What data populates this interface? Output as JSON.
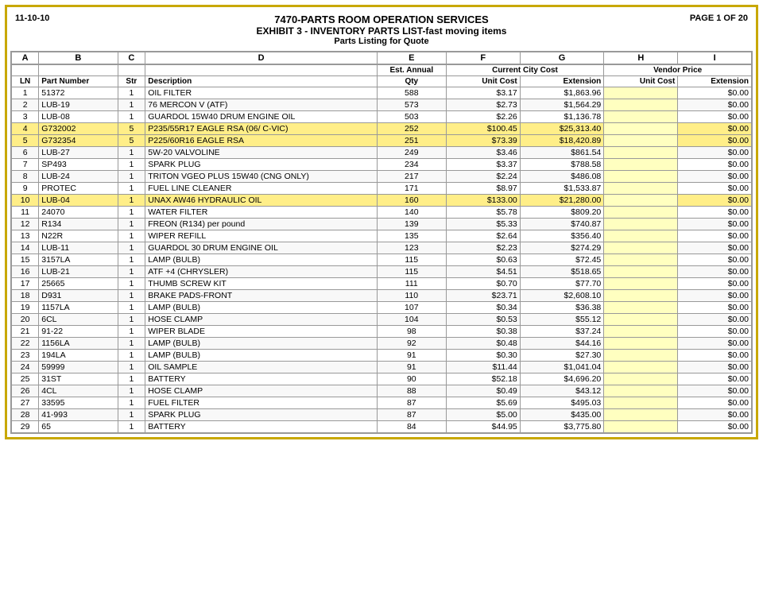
{
  "header": {
    "date": "11-10-10",
    "page": "PAGE 1 OF 20",
    "title1": "7470-PARTS ROOM OPERATION SERVICES",
    "title2": "EXHIBIT 3 - INVENTORY PARTS LIST-fast moving items",
    "title3": "Parts Listing for Quote"
  },
  "columns": {
    "letters": [
      "A",
      "B",
      "C",
      "D",
      "E",
      "F",
      "G",
      "H",
      "I"
    ],
    "subheaders_ef": "Est. Annual",
    "subheaders_fg": "Current City Cost",
    "subheaders_hi": "Vendor Price",
    "col_labels": {
      "ln": "LN",
      "part": "Part Number",
      "str": "Str",
      "desc": "Description",
      "qty": "Qty",
      "unit_cost": "Unit Cost",
      "extension": "Extension",
      "unit_cost2": "Unit Cost",
      "extension2": "Extension"
    }
  },
  "rows": [
    {
      "ln": 1,
      "part": "51372",
      "str": 1,
      "desc": "OIL FILTER",
      "qty": 588,
      "unit": "$3.17",
      "ext": "$1,863.96",
      "vunit": "",
      "vext": "$0.00"
    },
    {
      "ln": 2,
      "part": "LUB-19",
      "str": 1,
      "desc": "76 MERCON V (ATF)",
      "qty": 573,
      "unit": "$2.73",
      "ext": "$1,564.29",
      "vunit": "",
      "vext": "$0.00"
    },
    {
      "ln": 3,
      "part": "LUB-08",
      "str": 1,
      "desc": "GUARDOL 15W40 DRUM ENGINE OIL",
      "qty": 503,
      "unit": "$2.26",
      "ext": "$1,136.78",
      "vunit": "",
      "vext": "$0.00"
    },
    {
      "ln": 4,
      "part": "G732002",
      "str": 5,
      "desc": "P235/55R17 EAGLE RSA (06/ C-VIC)",
      "qty": 252,
      "unit": "$100.45",
      "ext": "$25,313.40",
      "vunit": "",
      "vext": "$0.00"
    },
    {
      "ln": 5,
      "part": "G732354",
      "str": 5,
      "desc": "P225/60R16 EAGLE RSA",
      "qty": 251,
      "unit": "$73.39",
      "ext": "$18,420.89",
      "vunit": "",
      "vext": "$0.00"
    },
    {
      "ln": 6,
      "part": "LUB-27",
      "str": 1,
      "desc": "5W-20 VALVOLINE",
      "qty": 249,
      "unit": "$3.46",
      "ext": "$861.54",
      "vunit": "",
      "vext": "$0.00"
    },
    {
      "ln": 7,
      "part": "SP493",
      "str": 1,
      "desc": "SPARK PLUG",
      "qty": 234,
      "unit": "$3.37",
      "ext": "$788.58",
      "vunit": "",
      "vext": "$0.00"
    },
    {
      "ln": 8,
      "part": "LUB-24",
      "str": 1,
      "desc": "TRITON VGEO PLUS 15W40 (CNG ONLY)",
      "qty": 217,
      "unit": "$2.24",
      "ext": "$486.08",
      "vunit": "",
      "vext": "$0.00"
    },
    {
      "ln": 9,
      "part": "PROTEC",
      "str": 1,
      "desc": "FUEL LINE CLEANER",
      "qty": 171,
      "unit": "$8.97",
      "ext": "$1,533.87",
      "vunit": "",
      "vext": "$0.00"
    },
    {
      "ln": 10,
      "part": "LUB-04",
      "str": 1,
      "desc": "UNAX AW46 HYDRAULIC OIL",
      "qty": 160,
      "unit": "$133.00",
      "ext": "$21,280.00",
      "vunit": "",
      "vext": "$0.00"
    },
    {
      "ln": 11,
      "part": "24070",
      "str": 1,
      "desc": "WATER FILTER",
      "qty": 140,
      "unit": "$5.78",
      "ext": "$809.20",
      "vunit": "",
      "vext": "$0.00"
    },
    {
      "ln": 12,
      "part": "R134",
      "str": 1,
      "desc": "FREON (R134) per pound",
      "qty": 139,
      "unit": "$5.33",
      "ext": "$740.87",
      "vunit": "",
      "vext": "$0.00"
    },
    {
      "ln": 13,
      "part": "N22R",
      "str": 1,
      "desc": "WIPER REFILL",
      "qty": 135,
      "unit": "$2.64",
      "ext": "$356.40",
      "vunit": "",
      "vext": "$0.00"
    },
    {
      "ln": 14,
      "part": "LUB-11",
      "str": 1,
      "desc": "GUARDOL 30 DRUM ENGINE OIL",
      "qty": 123,
      "unit": "$2.23",
      "ext": "$274.29",
      "vunit": "",
      "vext": "$0.00"
    },
    {
      "ln": 15,
      "part": "3157LA",
      "str": 1,
      "desc": "LAMP (BULB)",
      "qty": 115,
      "unit": "$0.63",
      "ext": "$72.45",
      "vunit": "",
      "vext": "$0.00"
    },
    {
      "ln": 16,
      "part": "LUB-21",
      "str": 1,
      "desc": "ATF +4 (CHRYSLER)",
      "qty": 115,
      "unit": "$4.51",
      "ext": "$518.65",
      "vunit": "",
      "vext": "$0.00"
    },
    {
      "ln": 17,
      "part": "25665",
      "str": 1,
      "desc": "THUMB SCREW KIT",
      "qty": 111,
      "unit": "$0.70",
      "ext": "$77.70",
      "vunit": "",
      "vext": "$0.00"
    },
    {
      "ln": 18,
      "part": "D931",
      "str": 1,
      "desc": "BRAKE PADS-FRONT",
      "qty": 110,
      "unit": "$23.71",
      "ext": "$2,608.10",
      "vunit": "",
      "vext": "$0.00"
    },
    {
      "ln": 19,
      "part": "1157LA",
      "str": 1,
      "desc": "LAMP (BULB)",
      "qty": 107,
      "unit": "$0.34",
      "ext": "$36.38",
      "vunit": "",
      "vext": "$0.00"
    },
    {
      "ln": 20,
      "part": "6CL",
      "str": 1,
      "desc": "HOSE CLAMP",
      "qty": 104,
      "unit": "$0.53",
      "ext": "$55.12",
      "vunit": "",
      "vext": "$0.00"
    },
    {
      "ln": 21,
      "part": "91-22",
      "str": 1,
      "desc": "WIPER BLADE",
      "qty": 98,
      "unit": "$0.38",
      "ext": "$37.24",
      "vunit": "",
      "vext": "$0.00"
    },
    {
      "ln": 22,
      "part": "1156LA",
      "str": 1,
      "desc": "LAMP (BULB)",
      "qty": 92,
      "unit": "$0.48",
      "ext": "$44.16",
      "vunit": "",
      "vext": "$0.00"
    },
    {
      "ln": 23,
      "part": "194LA",
      "str": 1,
      "desc": "LAMP (BULB)",
      "qty": 91,
      "unit": "$0.30",
      "ext": "$27.30",
      "vunit": "",
      "vext": "$0.00"
    },
    {
      "ln": 24,
      "part": "59999",
      "str": 1,
      "desc": "OIL SAMPLE",
      "qty": 91,
      "unit": "$11.44",
      "ext": "$1,041.04",
      "vunit": "",
      "vext": "$0.00"
    },
    {
      "ln": 25,
      "part": "31ST",
      "str": 1,
      "desc": "BATTERY",
      "qty": 90,
      "unit": "$52.18",
      "ext": "$4,696.20",
      "vunit": "",
      "vext": "$0.00"
    },
    {
      "ln": 26,
      "part": "4CL",
      "str": 1,
      "desc": "HOSE CLAMP",
      "qty": 88,
      "unit": "$0.49",
      "ext": "$43.12",
      "vunit": "",
      "vext": "$0.00"
    },
    {
      "ln": 27,
      "part": "33595",
      "str": 1,
      "desc": "FUEL FILTER",
      "qty": 87,
      "unit": "$5.69",
      "ext": "$495.03",
      "vunit": "",
      "vext": "$0.00"
    },
    {
      "ln": 28,
      "part": "41-993",
      "str": 1,
      "desc": "SPARK PLUG",
      "qty": 87,
      "unit": "$5.00",
      "ext": "$435.00",
      "vunit": "",
      "vext": "$0.00"
    },
    {
      "ln": 29,
      "part": "65",
      "str": 1,
      "desc": "BATTERY",
      "qty": 84,
      "unit": "$44.95",
      "ext": "$3,775.80",
      "vunit": "",
      "vext": "$0.00"
    }
  ],
  "highlighted_rows": [
    4,
    5,
    10
  ],
  "yellow_rows": [
    1,
    7,
    15,
    16,
    17,
    18,
    19,
    20,
    21,
    22,
    23
  ]
}
